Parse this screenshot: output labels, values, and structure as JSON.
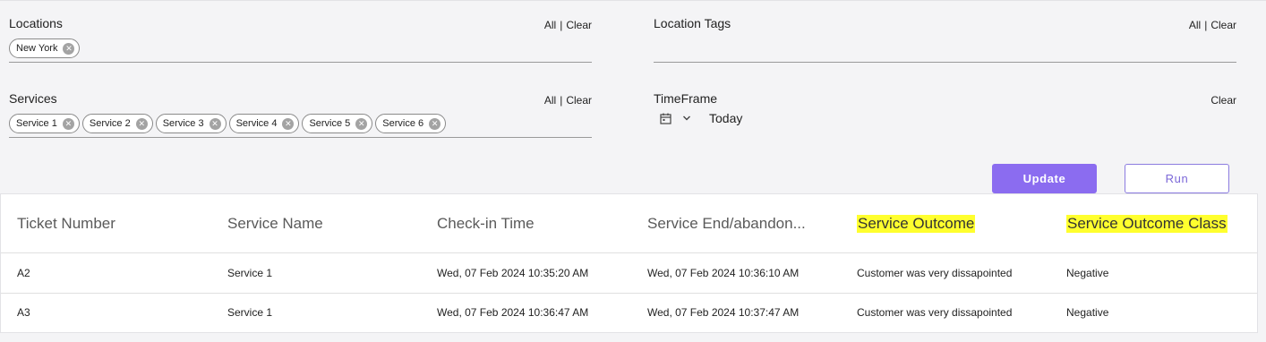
{
  "filters": {
    "locations": {
      "label": "Locations",
      "all": "All",
      "sep": "|",
      "clear": "Clear",
      "chips": [
        "New York"
      ]
    },
    "location_tags": {
      "label": "Location Tags",
      "all": "All",
      "sep": "|",
      "clear": "Clear",
      "chips": []
    },
    "services": {
      "label": "Services",
      "all": "All",
      "sep": "|",
      "clear": "Clear",
      "chips": [
        "Service 1",
        "Service 2",
        "Service 3",
        "Service 4",
        "Service 5",
        "Service 6"
      ]
    },
    "timeframe": {
      "label": "TimeFrame",
      "clear": "Clear",
      "value": "Today",
      "icons": [
        "calendar-icon",
        "chevron-down-icon"
      ]
    }
  },
  "buttons": {
    "update": "Update",
    "run": "Run"
  },
  "table": {
    "columns": [
      "Ticket Number",
      "Service Name",
      "Check-in Time",
      "Service End/abandon...",
      "Service Outcome",
      "Service Outcome Class"
    ],
    "highlighted_columns": [
      "Service Outcome",
      "Service Outcome Class"
    ],
    "rows": [
      [
        "A2",
        "Service 1",
        "Wed, 07 Feb 2024 10:35:20 AM",
        "Wed, 07 Feb 2024 10:36:10 AM",
        "Customer was very dissapointed",
        "Negative"
      ],
      [
        "A3",
        "Service 1",
        "Wed, 07 Feb 2024 10:36:47 AM",
        "Wed, 07 Feb 2024 10:37:47 AM",
        "Customer was very dissapointed",
        "Negative"
      ]
    ]
  },
  "colors": {
    "accent": "#8b6cf0",
    "highlight": "#ffff2e",
    "background": "#f4f4f6"
  }
}
